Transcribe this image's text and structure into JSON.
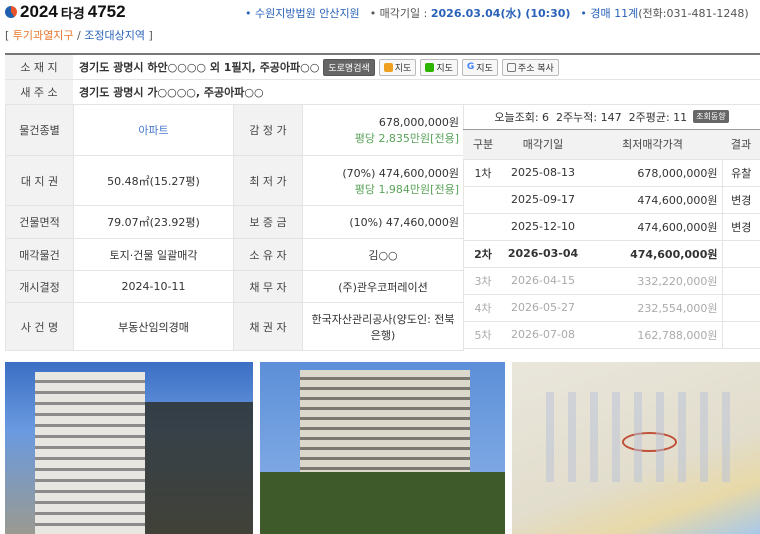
{
  "header": {
    "case_prefix": "2024",
    "case_mid": "타경",
    "case_num": "4752",
    "court": "• 수원지방법원 안산지원",
    "sale_label": "• 매각기일 : ",
    "sale_date": "2026.03.04(水) (10:30)",
    "dept": "• 경매 11계",
    "phone": "(전화:031-481-1248)"
  },
  "zones": {
    "open": "[ ",
    "z1": "투기과열지구",
    "sep": " / ",
    "z2": "조정대상지역",
    "close": " ]"
  },
  "address": {
    "label": "소 재 지",
    "value": "경기도 광명시 하안○○○○ 외 1필지, 주공아파○○",
    "buttons": [
      "도로명검색",
      "지도",
      "지도",
      "지도",
      "주소 복사"
    ],
    "new_label": "새 주 소",
    "new_value": "경기도 광명시 가○○○○, 주공아파○○"
  },
  "rows": [
    {
      "l1": "물건종별",
      "v1": "아파트",
      "l2": "감 정 가",
      "v2": "678,000,000원",
      "v2b": "평당 2,835만원[전용]"
    },
    {
      "l1": "대 지 권",
      "v1": "50.48㎡(15.27평)",
      "l2": "최 저 가",
      "v2": "(70%) 474,600,000원",
      "v2b": "평당 1,984만원[전용]"
    },
    {
      "l1": "건물면적",
      "v1": "79.07㎡(23.92평)",
      "l2": "보 증 금",
      "v2": "(10%) 47,460,000원"
    },
    {
      "l1": "매각물건",
      "v1": "토지·건물 일괄매각",
      "l2": "소 유 자",
      "v2": "김○○"
    },
    {
      "l1": "개시결정",
      "v1": "2024-10-11",
      "l2": "채 무 자",
      "v2": "(주)관우코퍼레이션"
    },
    {
      "l1": "사 건 명",
      "v1": "부동산임의경매",
      "l2": "채 권 자",
      "v2": "한국자산관리공사(양도인: 전북은행)"
    }
  ],
  "stats": {
    "text": "오늘조회: 6  2주누적: 147  2주평균: 11",
    "button": "조회동향"
  },
  "history": {
    "headers": [
      "구분",
      "매각기일",
      "최저매각가격",
      "결과"
    ],
    "rows": [
      [
        "1차",
        "2025-08-13",
        "678,000,000원",
        "유찰"
      ],
      [
        "",
        "2025-09-17",
        "474,600,000원",
        "변경"
      ],
      [
        "",
        "2025-12-10",
        "474,600,000원",
        "변경"
      ],
      [
        "2차",
        "2026-03-04",
        "474,600,000원",
        ""
      ],
      [
        "3차",
        "2026-04-15",
        "332,220,000원",
        ""
      ],
      [
        "4차",
        "2026-05-27",
        "232,554,000원",
        ""
      ],
      [
        "5차",
        "2026-07-08",
        "162,788,000원",
        ""
      ]
    ]
  }
}
